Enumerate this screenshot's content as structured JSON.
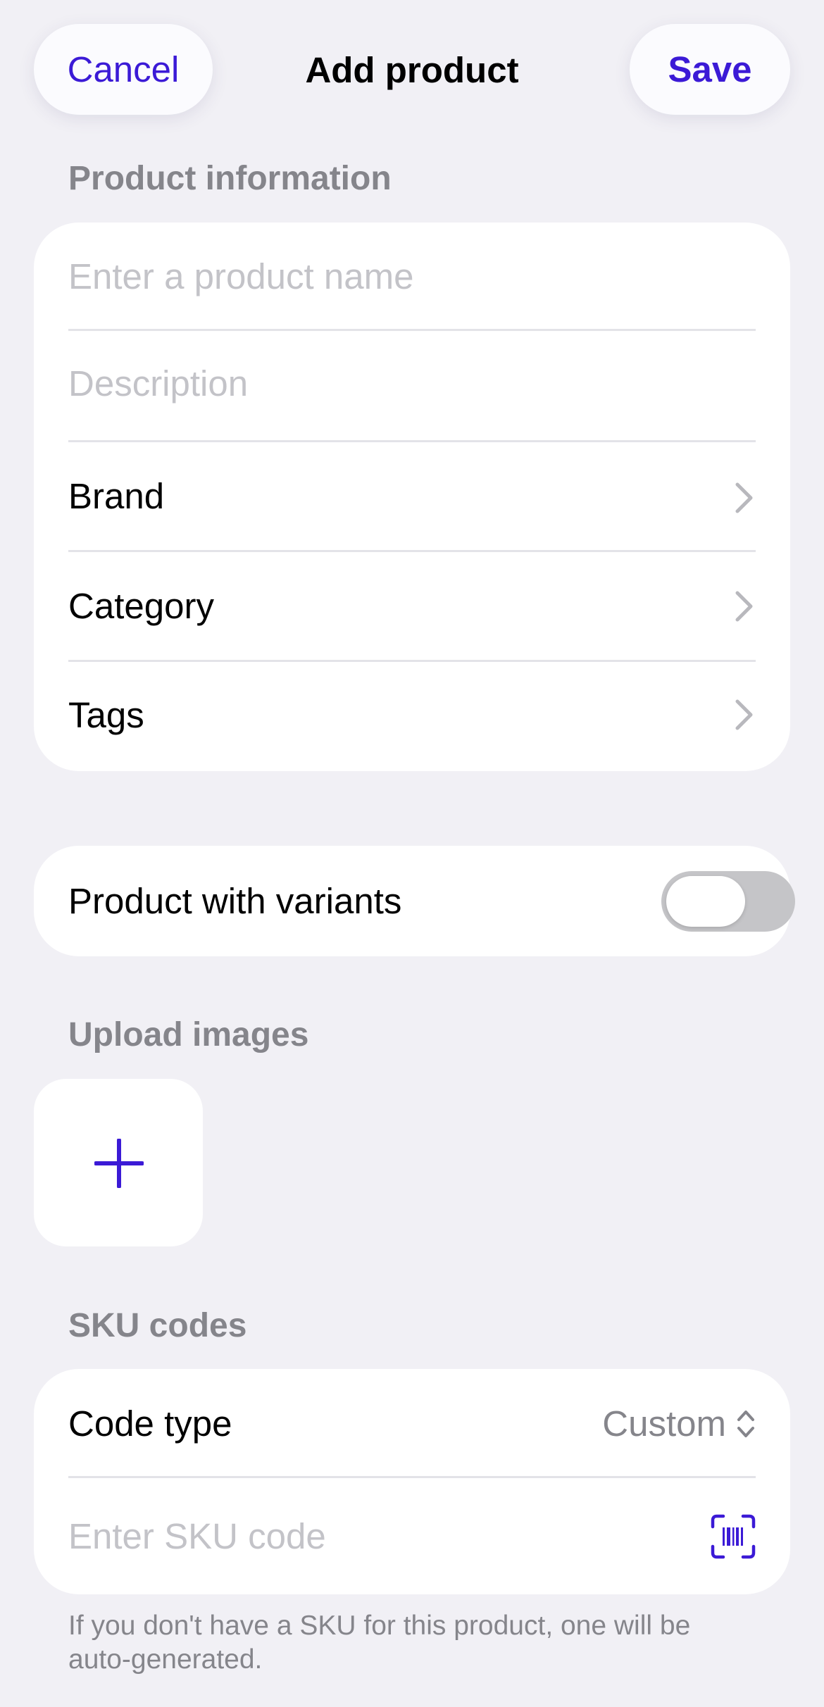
{
  "header": {
    "cancel_label": "Cancel",
    "title": "Add product",
    "save_label": "Save"
  },
  "product_information": {
    "section_label": "Product information",
    "name_placeholder": "Enter a product name",
    "description_placeholder": "Description",
    "rows": [
      {
        "label": "Brand"
      },
      {
        "label": "Category"
      },
      {
        "label": "Tags"
      }
    ]
  },
  "variants": {
    "label": "Product with variants",
    "enabled": false
  },
  "images": {
    "section_label": "Upload images",
    "add_icon": "plus-icon"
  },
  "sku": {
    "section_label": "SKU codes",
    "code_type_label": "Code type",
    "code_type_value": "Custom",
    "code_placeholder": "Enter SKU code",
    "scan_icon": "barcode-scan-icon",
    "note": "If you don't have a SKU for this product, one will be auto-generated."
  },
  "colors": {
    "accent": "#3b1ad6",
    "background": "#f1f0f5",
    "secondary_text": "#85858b",
    "placeholder": "#c3c3c8"
  }
}
